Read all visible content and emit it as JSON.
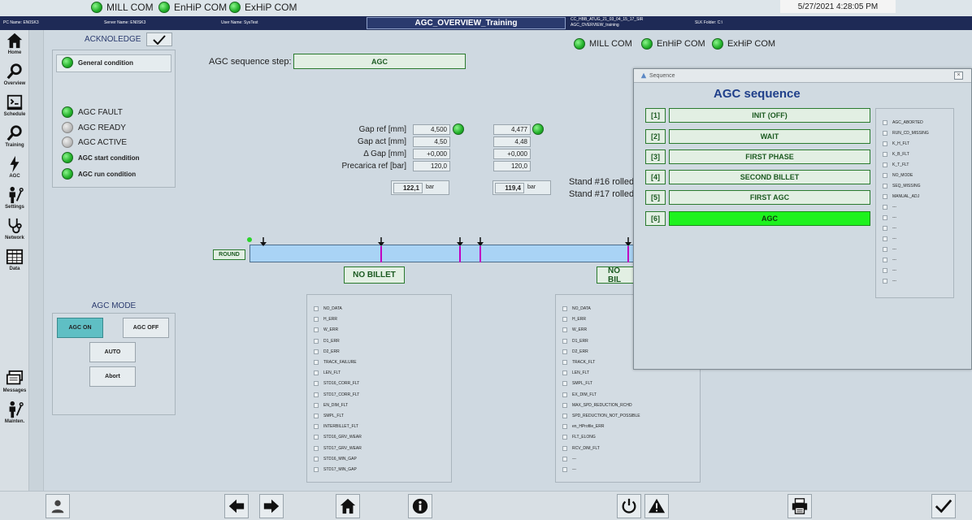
{
  "top_status": {
    "items": [
      {
        "label": "MILL COM"
      },
      {
        "label": "EnHiP COM"
      },
      {
        "label": "ExHiP COM"
      }
    ],
    "datetime": "5/27/2021 4:28:05 PM"
  },
  "titlebar": {
    "pc_name": "PC Name: EN0SK3",
    "server_name": "Server Name: EN0SK3",
    "user_name": "User Name: SysTest",
    "title": "AGC_OVERVIEW_Training",
    "project_line1": "CC_HBB_ATUG_21_03_04_15_17_SIR",
    "project_line2": "AGC_OVERVIEW_training",
    "slk_folder": "SLK Folder: C:\\"
  },
  "nav": {
    "items": [
      {
        "label": "Home",
        "icon": "home-icon"
      },
      {
        "label": "Overview",
        "icon": "magnifier-icon"
      },
      {
        "label": "Schedule",
        "icon": "schedule-icon"
      },
      {
        "label": "Training",
        "icon": "magnifier-icon"
      },
      {
        "label": "AGC",
        "icon": "lightning-icon"
      },
      {
        "label": "Settings",
        "icon": "person-wrench-icon"
      },
      {
        "label": "Network",
        "icon": "stethoscope-icon"
      },
      {
        "label": "Data",
        "icon": "table-icon"
      },
      {
        "label": "Messages",
        "icon": "messages-icon"
      },
      {
        "label": "Mainten.",
        "icon": "person-wrench-icon"
      }
    ]
  },
  "acknowledge": {
    "label": "ACKNOLEDGE"
  },
  "conditions": {
    "general": "General condition",
    "fault": "AGC FAULT",
    "ready": "AGC READY",
    "active": "AGC ACTIVE",
    "start": "AGC start condition",
    "run": "AGC run condition"
  },
  "agc_step": {
    "label": "AGC sequence step:",
    "value": "AGC"
  },
  "com_right": {
    "items": [
      {
        "label": "MILL COM"
      },
      {
        "label": "EnHiP COM"
      },
      {
        "label": "ExHiP COM"
      }
    ]
  },
  "gap": {
    "labels": [
      "Gap ref [mm]",
      "Gap act [mm]",
      "Δ Gap [mm]",
      "Precarica ref [bar]"
    ],
    "stand16": [
      "4,500",
      "4,50",
      "+0,000",
      "120,0"
    ],
    "stand17": [
      "4,477",
      "4,48",
      "+0,000",
      "120,0"
    ],
    "pressure16": "122,1",
    "pressure17": "119,4",
    "unit": "bar"
  },
  "stand_text": [
    "Stand #16 rolled",
    "Stand #17 rolled"
  ],
  "billet": {
    "round_label": "ROUND",
    "no_billet_1": "NO BILLET",
    "no_billet_2": "NO BIL"
  },
  "agc_mode": {
    "title": "AGC MODE",
    "on": "AGC ON",
    "off": "AGC OFF",
    "auto": "AUTO",
    "abort": "Abort"
  },
  "faults_16": [
    "NO_DATA",
    "H_ERR",
    "W_ERR",
    "D1_ERR",
    "D2_ERR",
    "TRACK_FAILURE",
    "LEN_FLT",
    "STD16_CORR_FLT",
    "STD17_CORR_FLT",
    "EN_DIM_FLT",
    "SMPL_FLT",
    "INTERBILLET_FLT",
    "STD16_GRV_WEAR",
    "STD17_GRV_WEAR",
    "STD16_MIN_GAP",
    "STD17_MIN_GAP"
  ],
  "faults_17": [
    "NO_DATA",
    "H_ERR",
    "W_ERR",
    "D1_ERR",
    "D2_ERR",
    "TRACK_FLT",
    "LEN_FLT",
    "SMPL_FLT",
    "EX_DIM_FLT",
    "MAX_SPD_REDUCTION_RCHD",
    "SPD_REDUCTION_NOT_POSSIBLE",
    "en_HProfile_ERR",
    "FLT_ELONG",
    "RCV_DIM_FLT",
    "---",
    "---"
  ],
  "sequence": {
    "window_title": "Sequence",
    "title": "AGC sequence",
    "steps": [
      {
        "num": "[1]",
        "label": "INIT (OFF)"
      },
      {
        "num": "[2]",
        "label": "WAIT"
      },
      {
        "num": "[3]",
        "label": "FIRST PHASE"
      },
      {
        "num": "[4]",
        "label": "SECOND BILLET"
      },
      {
        "num": "[5]",
        "label": "FIRST AGC"
      },
      {
        "num": "[6]",
        "label": "AGC"
      }
    ],
    "flags": [
      "AGC_ABORTED",
      "RUN_CD_MISSING",
      "K_H_FLT",
      "K_B_FLT",
      "K_T_FLT",
      "NO_MODE",
      "SEQ_MISSING",
      "MANUAL_ADJ",
      "---",
      "---",
      "---",
      "---",
      "---",
      "---",
      "---",
      "---"
    ]
  },
  "colors": {
    "accent_green": "#1ef21e",
    "title_bar": "#1e2a56",
    "agc_on": "#5fbfc4"
  }
}
